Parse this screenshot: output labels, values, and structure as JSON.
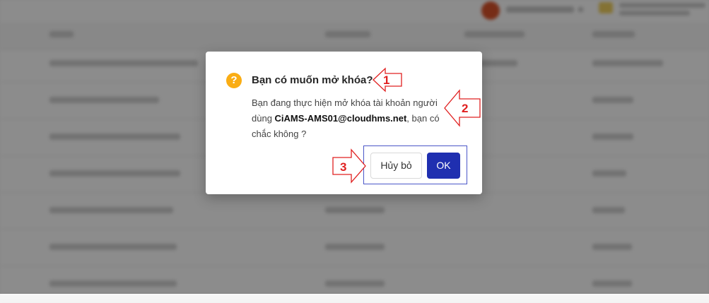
{
  "dialog": {
    "title": "Bạn có muốn mở khóa?",
    "message_prefix": "Bạn đang thực hiện mở khóa tài khoản người dùng ",
    "account": "CiAMS-AMS01@cloudhms.net",
    "message_suffix": ", bạn có chắc không ?",
    "cancel_label": "Hủy bỏ",
    "ok_label": "OK",
    "icon": "question-circle-icon"
  },
  "annotations": {
    "marker_1": "1",
    "marker_2": "2",
    "marker_3": "3"
  },
  "colors": {
    "primary": "#1f2fb0",
    "warning": "#faad14",
    "annotation": "#e02020",
    "highlight_box": "#4a56c8"
  }
}
